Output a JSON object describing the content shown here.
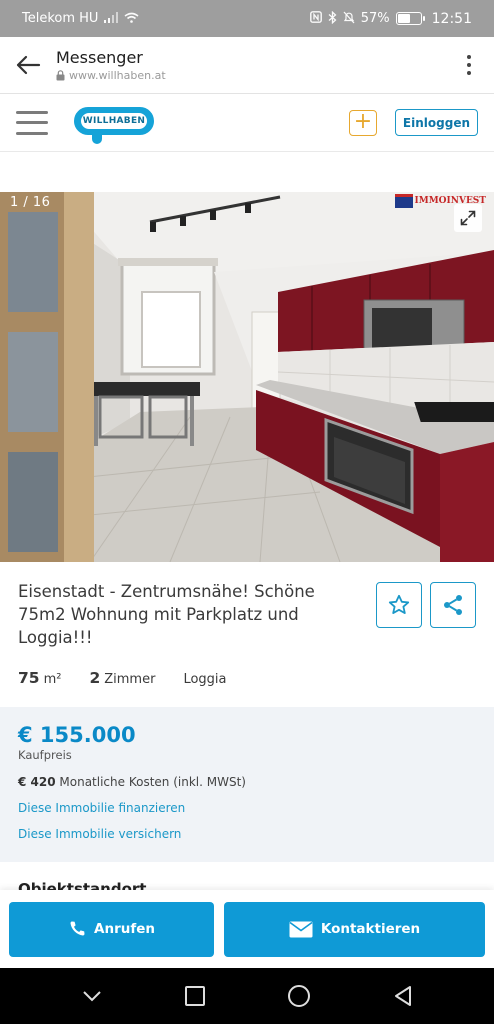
{
  "status_bar": {
    "carrier": "Telekom HU",
    "battery": "57%",
    "battery_level": 0.57,
    "time": "12:51"
  },
  "browser_header": {
    "title": "Messenger",
    "url": "www.willhaben.at"
  },
  "site_nav": {
    "logo_text": "WILLHABEN",
    "add_label": "+",
    "login_label": "Einloggen"
  },
  "gallery": {
    "counter": "1 / 16",
    "watermark": "IMMOINVEST"
  },
  "listing": {
    "title": "Eisenstadt - Zentrumsnähe! Schöne 75m2 Wohnung mit Parkplatz und Loggia!!!",
    "area_value": "75",
    "area_unit": "m²",
    "rooms_value": "2",
    "rooms_unit": "Zimmer",
    "feature": "Loggia"
  },
  "price": {
    "amount": "€ 155.000",
    "label": "Kaufpreis",
    "monthly_amount": "€ 420",
    "monthly_label": "Monatliche Kosten (inkl. MWSt)",
    "finance_link": "Diese Immobilie finanzieren",
    "insure_link": "Diese Immobilie versichern"
  },
  "location_heading": "Objektstandort",
  "actions": {
    "call_label": "Anrufen",
    "contact_label": "Kontaktieren"
  },
  "colors": {
    "accent": "#0f9ad6",
    "plus": "#e7a82f",
    "price": "#0a89c7"
  }
}
